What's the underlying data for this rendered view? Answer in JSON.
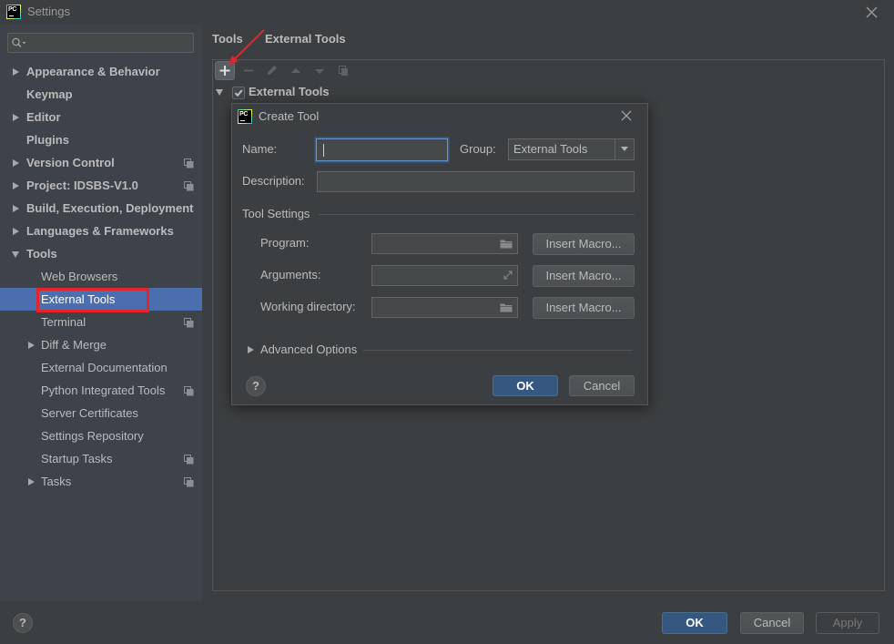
{
  "window": {
    "title": "Settings",
    "app_icon": "pycharm-icon",
    "app_icon_text": "PC"
  },
  "colors": {
    "background": "#3c3f41",
    "sidebar-bg": "#3e4249",
    "text": "#bbbbbb",
    "selection": "#4b6eaf",
    "default-button": "#365880",
    "annotation": "#e3242b"
  },
  "search": {
    "value": "",
    "icon": "search-icon"
  },
  "sidebar": {
    "items": [
      {
        "label": "Appearance & Behavior",
        "level": 0,
        "expandable": true,
        "expanded": false
      },
      {
        "label": "Keymap",
        "level": 0
      },
      {
        "label": "Editor",
        "level": 0,
        "expandable": true,
        "expanded": false
      },
      {
        "label": "Plugins",
        "level": 0
      },
      {
        "label": "Version Control",
        "level": 0,
        "expandable": true,
        "expanded": false,
        "project_level": true
      },
      {
        "label": "Project: IDSBS-V1.0",
        "level": 0,
        "expandable": true,
        "expanded": false,
        "project_level": true
      },
      {
        "label": "Build, Execution, Deployment",
        "level": 0,
        "expandable": true,
        "expanded": false
      },
      {
        "label": "Languages & Frameworks",
        "level": 0,
        "expandable": true,
        "expanded": false
      },
      {
        "label": "Tools",
        "level": 0,
        "expandable": true,
        "expanded": true
      },
      {
        "label": "Web Browsers",
        "level": 1
      },
      {
        "label": "External Tools",
        "level": 1,
        "selected": true
      },
      {
        "label": "Terminal",
        "level": 1,
        "project_level": true
      },
      {
        "label": "Diff & Merge",
        "level": 1,
        "expandable": true,
        "expanded": false
      },
      {
        "label": "External Documentation",
        "level": 1
      },
      {
        "label": "Python Integrated Tools",
        "level": 1,
        "project_level": true
      },
      {
        "label": "Server Certificates",
        "level": 1
      },
      {
        "label": "Settings Repository",
        "level": 1
      },
      {
        "label": "Startup Tasks",
        "level": 1,
        "project_level": true
      },
      {
        "label": "Tasks",
        "level": 1,
        "expandable": true,
        "expanded": false,
        "project_level": true
      }
    ]
  },
  "breadcrumb": {
    "parent": "Tools",
    "current": "External Tools"
  },
  "toolbar": {
    "buttons": [
      {
        "icon": "add-icon",
        "enabled": true
      },
      {
        "icon": "remove-icon",
        "enabled": false
      },
      {
        "icon": "edit-icon",
        "enabled": false
      },
      {
        "icon": "move-up-icon",
        "enabled": false
      },
      {
        "icon": "move-down-icon",
        "enabled": false
      },
      {
        "icon": "copy-icon",
        "enabled": false
      }
    ]
  },
  "tree": {
    "group": {
      "label": "External Tools",
      "checked": true,
      "expanded": true
    }
  },
  "dialog": {
    "title": "Create Tool",
    "name": {
      "label": "Name:",
      "value": ""
    },
    "group": {
      "label": "Group:",
      "value": "External Tools"
    },
    "description": {
      "label": "Description:",
      "value": ""
    },
    "tool_settings": {
      "title": "Tool Settings",
      "rows": [
        {
          "label": "Program:",
          "value": "",
          "field_icon": "folder-icon",
          "button": "Insert Macro..."
        },
        {
          "label": "Arguments:",
          "value": "",
          "field_icon": "expand-icon",
          "button": "Insert Macro..."
        },
        {
          "label": "Working directory:",
          "value": "",
          "field_icon": "folder-icon",
          "button": "Insert Macro..."
        }
      ]
    },
    "advanced_options": {
      "label": "Advanced Options",
      "expanded": false
    },
    "help": "?",
    "ok": "OK",
    "cancel": "Cancel"
  },
  "footer": {
    "help": "?",
    "ok": "OK",
    "cancel": "Cancel",
    "apply": "Apply",
    "apply_enabled": false
  }
}
